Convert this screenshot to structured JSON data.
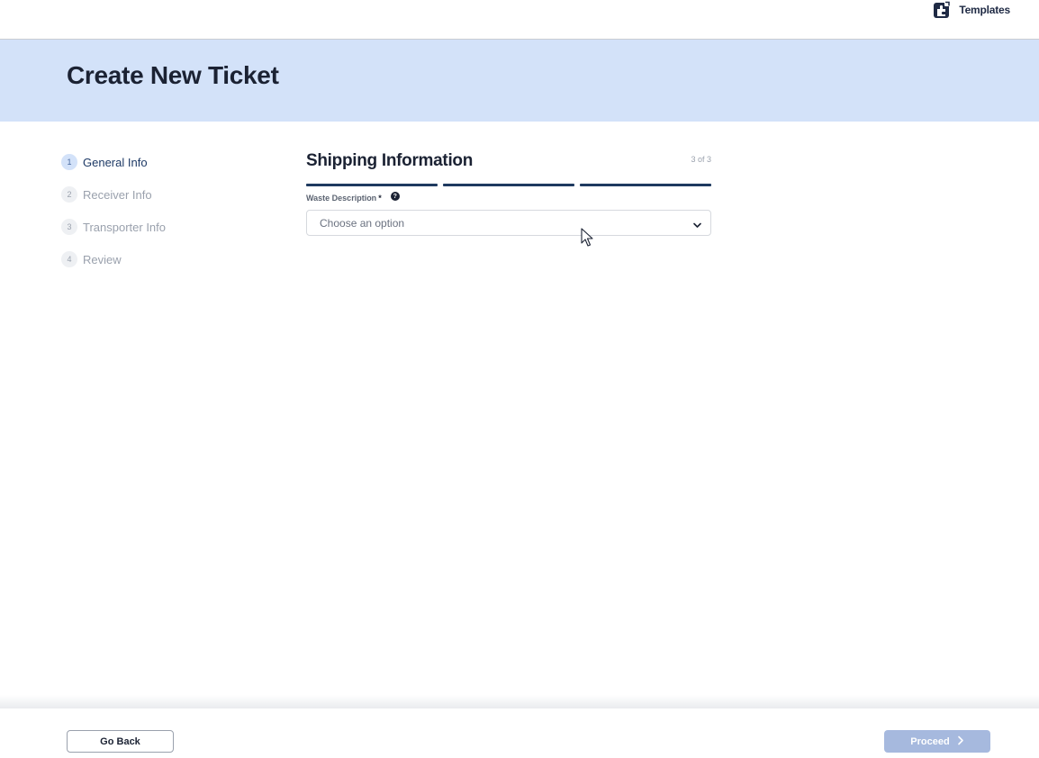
{
  "topbar": {
    "templates_label": "Templates",
    "templates_icon": "puzzle-piece-icon"
  },
  "page": {
    "title": "Create New Ticket"
  },
  "steps": [
    {
      "number": "1",
      "label": "General Info",
      "active": true
    },
    {
      "number": "2",
      "label": "Receiver Info",
      "active": false
    },
    {
      "number": "3",
      "label": "Transporter Info",
      "active": false
    },
    {
      "number": "4",
      "label": "Review",
      "active": false
    }
  ],
  "form": {
    "title": "Shipping Information",
    "counter": "3 of 3",
    "progress_segments_total": 3,
    "progress_segments_filled": 3,
    "field": {
      "label": "Waste Description",
      "required_mark": "*",
      "help_icon": "question-circle-icon",
      "help_glyph": "?",
      "placeholder": "Choose an option",
      "chevron_icon": "chevron-down-icon"
    }
  },
  "footer": {
    "back_label": "Go Back",
    "proceed_label": "Proceed",
    "proceed_icon": "chevron-right-icon"
  },
  "colors": {
    "hero_bg": "#d3e2f9",
    "progress": "#1f3a60",
    "proceed_bg": "#a6b9de",
    "active_step": "#1e3a66"
  }
}
